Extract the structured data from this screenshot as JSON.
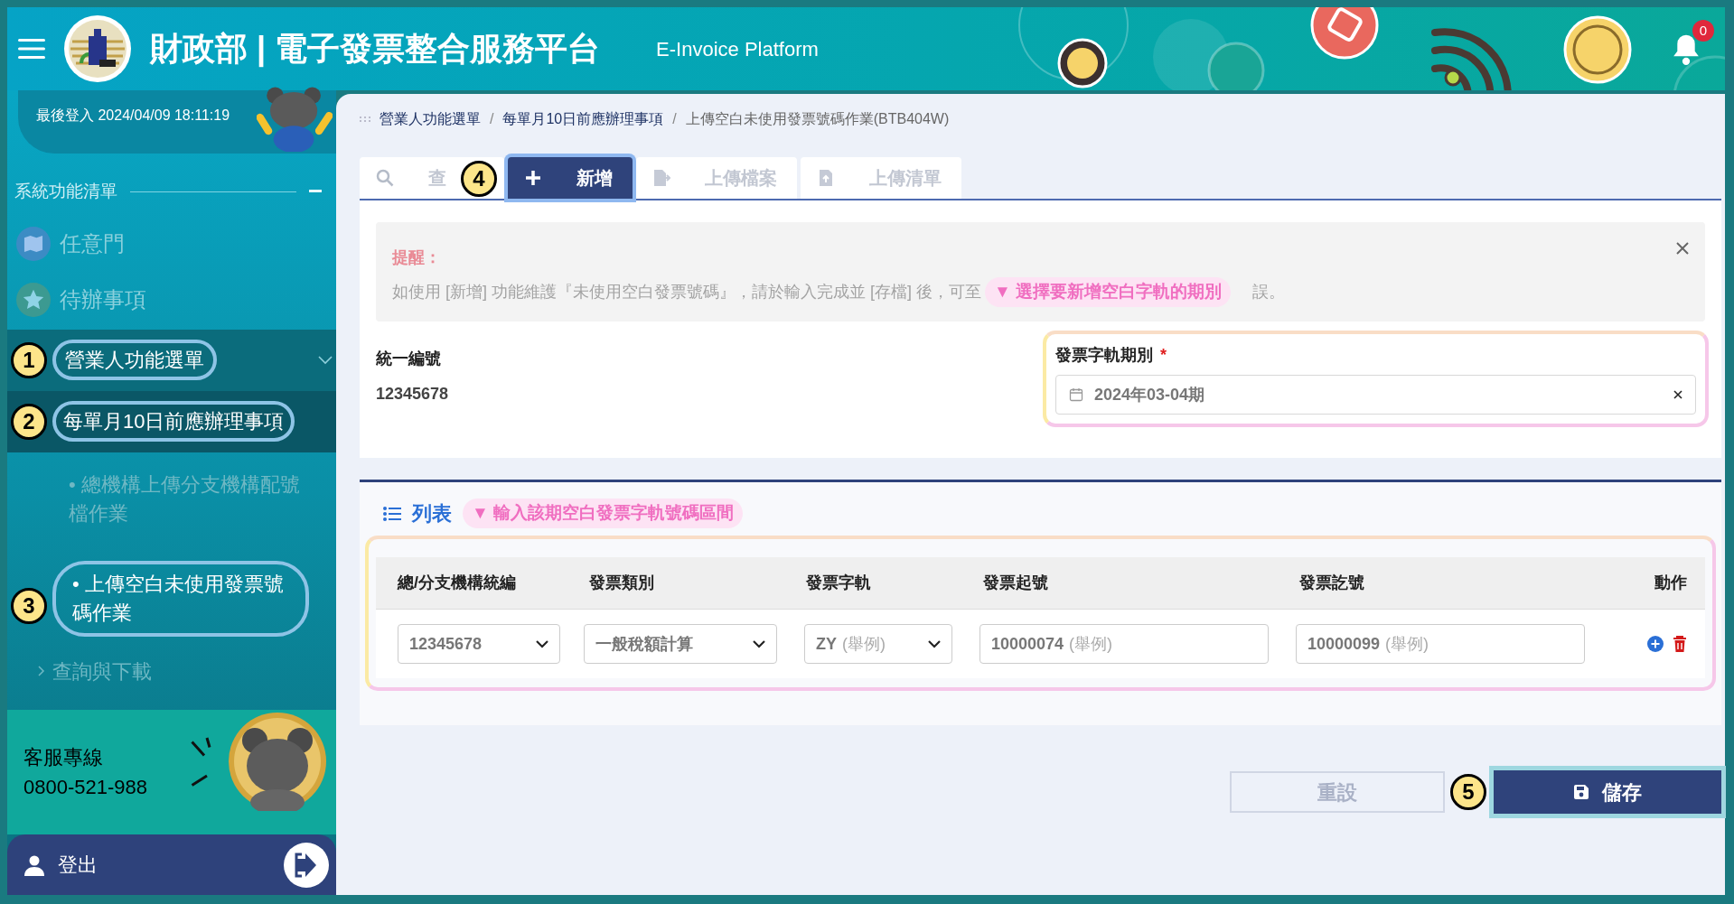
{
  "header": {
    "title": "財政部 | 電子發票整合服務平台",
    "subtitle": "E-Invoice Platform",
    "notification_count": "0"
  },
  "sidebar": {
    "last_login": "最後登入 2024/04/09 18:11:19",
    "menu_title": "系統功能清單",
    "shortcuts": [
      {
        "label": "任意門",
        "kind": "map"
      },
      {
        "label": "待辦事項",
        "kind": "star"
      }
    ],
    "menu": [
      {
        "label": "營業人功能選單",
        "expanded": true,
        "callout": "1",
        "children": [
          {
            "label": "每單月10日前應辦理事項",
            "expanded": true,
            "callout": "2",
            "children": [
              {
                "bullet": "•",
                "label": "總機構上傳分支機構配號檔作業",
                "selected": false
              },
              {
                "bullet": "•",
                "label": "上傳空白未使用發票號碼作業",
                "selected": true,
                "callout": "3"
              }
            ]
          },
          {
            "label": "查詢與下載",
            "expanded": false
          }
        ]
      }
    ],
    "support": {
      "label": "客服專線",
      "phone": "0800-521-988"
    },
    "logout": {
      "label": "登出"
    }
  },
  "breadcrumb": {
    "separator": "/",
    "items": [
      "營業人功能選單",
      "每單月10日前應辦理事項",
      "上傳空白未使用發票號碼作業(BTB404W)"
    ]
  },
  "tabs": [
    {
      "label": "查",
      "kind": "search",
      "selected": false
    },
    {
      "label": "新增",
      "kind": "add",
      "selected": true,
      "callout": "4"
    },
    {
      "label": "上傳檔案",
      "kind": "upload-file",
      "selected": false
    },
    {
      "label": "上傳清單",
      "kind": "upload-list",
      "selected": false
    }
  ],
  "notice": {
    "title": "提醒：",
    "text_before": "如使用 [新增] 功能維護『未使用空白發票號碼』，請於輸入完成並 [存檔] 後，可至",
    "text_after": "誤。"
  },
  "tax_id": {
    "label": "統一編號",
    "value": "12345678"
  },
  "period": {
    "label": "發票字軌期別",
    "required_mark": "*",
    "value": "2024年03-04期",
    "hint": "▼ 選擇要新增空白字軌的期別"
  },
  "list": {
    "title": "列表",
    "hint": "▼ 輸入該期空白發票字軌號碼區間",
    "columns": [
      "總/分支機構統編",
      "發票類別",
      "發票字軌",
      "發票起號",
      "發票訖號",
      "動作"
    ],
    "rows": [
      {
        "branch": "12345678",
        "type": "一般稅額計算",
        "track": "ZY",
        "track_note": "(舉例)",
        "start": "10000074",
        "start_note": "(舉例)",
        "end": "10000099",
        "end_note": "(舉例)"
      }
    ]
  },
  "buttons": [
    {
      "label": "重設",
      "kind": "reset",
      "disabled": true
    },
    {
      "label": "儲存",
      "kind": "save",
      "disabled": false,
      "callout": "5"
    }
  ]
}
